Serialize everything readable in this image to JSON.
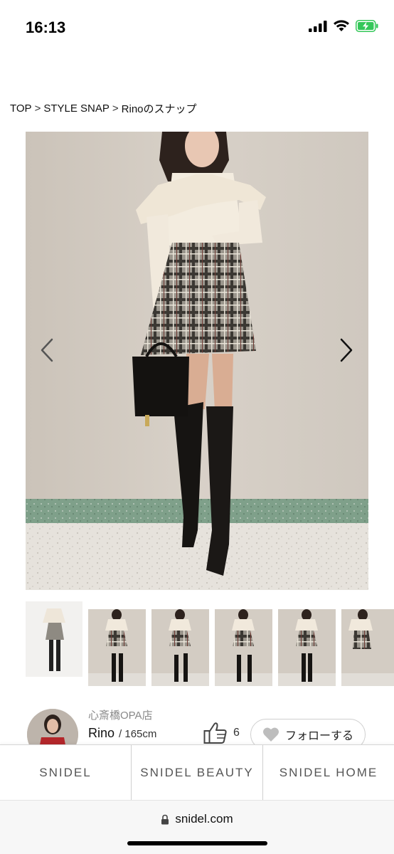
{
  "status_bar": {
    "time": "16:13",
    "icons": [
      "signal-icon",
      "wifi-icon",
      "battery-charging-icon"
    ],
    "battery_color": "#34c759"
  },
  "breadcrumb": [
    {
      "label": "TOP"
    },
    {
      "label": "STYLE SNAP"
    },
    {
      "label": "Rinoのスナップ"
    }
  ],
  "breadcrumb_separator": ">",
  "gallery": {
    "prev_icon": "chevron-left-icon",
    "next_icon": "chevron-right-icon",
    "thumbnail_count": 6
  },
  "staff": {
    "shop": "心斎橋OPA店",
    "name": "Rino",
    "height": "/ 165cm",
    "likes": "6",
    "follow_label": "フォローする"
  },
  "brand_tabs": [
    {
      "label": "SNIDEL"
    },
    {
      "label": "SNIDEL BEAUTY"
    },
    {
      "label": "SNIDEL HOME"
    }
  ],
  "browser": {
    "url": "snidel.com"
  }
}
